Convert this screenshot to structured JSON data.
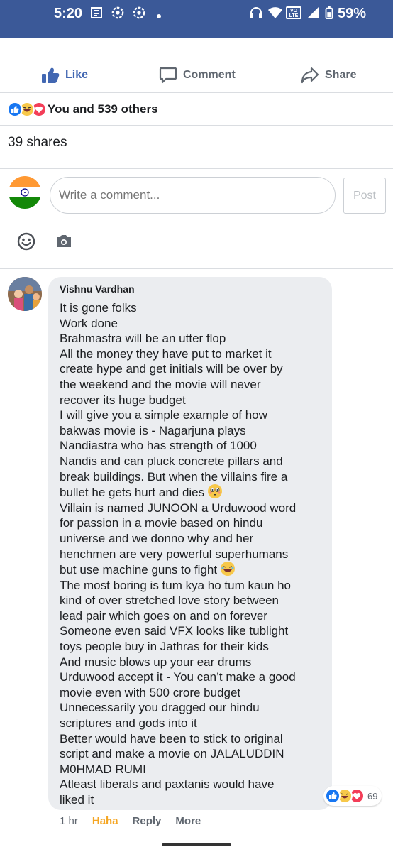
{
  "status_bar": {
    "time": "5:20",
    "battery": "59%",
    "lte_label": "VO LTE",
    "bg_color": "#3b5998"
  },
  "actions": {
    "like": "Like",
    "comment": "Comment",
    "share": "Share"
  },
  "reactions": {
    "summary": "You and 539 others",
    "icons": [
      "like-icon",
      "haha-icon",
      "love-icon"
    ]
  },
  "shares": "39 shares",
  "composer": {
    "placeholder": "Write a comment...",
    "post_label": "Post"
  },
  "comment": {
    "author": "Vishnu Vardhan",
    "lines": [
      "It is gone folks",
      "Work done",
      "Brahmastra will be an utter flop",
      "All the money they have put to market it",
      "create hype and get initials will be over by",
      "the weekend and the movie will never",
      "recover its huge budget",
      "I will give you a simple example of how",
      "bakwas movie is - Nagarjuna plays",
      "Nandiastra who has strength of 1000",
      "Nandis and can pluck concrete pillars and",
      "break buildings. But when the villains fire a",
      "bullet he gets hurt and dies",
      "Villain is named JUNOON a Urduwood word",
      "for passion in a movie based on hindu",
      "universe and we donno why and her",
      "henchmen are very powerful superhumans",
      "but use machine guns to fight",
      "The most boring is tum kya ho tum kaun ho",
      "kind of over stretched love story between",
      "lead pair which goes on and on forever",
      "Someone even said VFX looks like tublight",
      "toys people buy in Jathras for their kids",
      "And music blows up your ear drums",
      "Urduwood accept it - You can’t make a good",
      "movie even with 500 crore budget",
      "Unnecessarily you dragged our hindu",
      "scriptures and gods into it",
      "Better would have been to stick to original",
      "script and make a movie on JALALUDDIN",
      "M0HMAD RUMI",
      "Atleast liberals and paxtanis would have",
      "liked it"
    ],
    "reaction_count": "69",
    "time": "1 hr",
    "haha": "Haha",
    "reply": "Reply",
    "more": "More"
  }
}
